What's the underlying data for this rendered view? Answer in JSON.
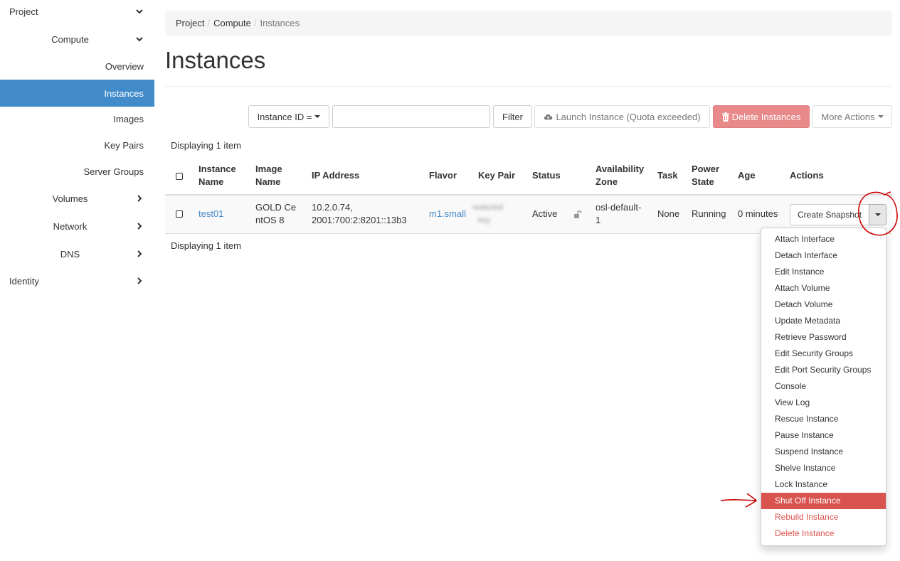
{
  "sidebar": {
    "project": "Project",
    "compute": "Compute",
    "overview": "Overview",
    "instances": "Instances",
    "images": "Images",
    "key_pairs": "Key Pairs",
    "server_groups": "Server Groups",
    "volumes": "Volumes",
    "network": "Network",
    "dns": "DNS",
    "identity": "Identity",
    "active_item": "Instances"
  },
  "breadcrumb": {
    "items": [
      "Project",
      "Compute",
      "Instances"
    ],
    "separator": "/"
  },
  "page_title": "Instances",
  "toolbar": {
    "filter_type": "Instance ID =",
    "search_value": "",
    "filter_label": "Filter",
    "launch_label": "Launch Instance (Quota exceeded)",
    "delete_label": "Delete Instances",
    "more_label": "More Actions"
  },
  "display_count": "Displaying 1 item",
  "table": {
    "headers": {
      "instance_name": [
        "Instance",
        "Name"
      ],
      "image_name": [
        "Image",
        "Name"
      ],
      "ip_address": "IP Address",
      "flavor": "Flavor",
      "key_pair": "Key Pair",
      "status": "Status",
      "availability_zone": [
        "Availability",
        "Zone"
      ],
      "task": "Task",
      "power_state": [
        "Power",
        "State"
      ],
      "age": "Age",
      "actions": "Actions"
    },
    "rows": [
      {
        "instance_name": "test01",
        "image_name": [
          "GOLD Ce",
          "ntOS 8"
        ],
        "ip_address": [
          "10.2.0.74,",
          "2001:700:2:8201::13b3"
        ],
        "flavor": "m1.small",
        "key_pair": [
          "redacted",
          "key"
        ],
        "status": "Active",
        "availability_zone": [
          "osl-default-",
          "1"
        ],
        "task": "None",
        "power_state": "Running",
        "age": "0 minutes",
        "action_primary": "Create Snapshot"
      }
    ]
  },
  "actions_menu": {
    "items": [
      {
        "label": "Attach Interface",
        "style": "normal"
      },
      {
        "label": "Detach Interface",
        "style": "normal"
      },
      {
        "label": "Edit Instance",
        "style": "normal"
      },
      {
        "label": "Attach Volume",
        "style": "normal"
      },
      {
        "label": "Detach Volume",
        "style": "normal"
      },
      {
        "label": "Update Metadata",
        "style": "normal"
      },
      {
        "label": "Retrieve Password",
        "style": "normal"
      },
      {
        "label": "Edit Security Groups",
        "style": "normal"
      },
      {
        "label": "Edit Port Security Groups",
        "style": "normal"
      },
      {
        "label": "Console",
        "style": "normal"
      },
      {
        "label": "View Log",
        "style": "normal"
      },
      {
        "label": "Rescue Instance",
        "style": "normal"
      },
      {
        "label": "Pause Instance",
        "style": "normal"
      },
      {
        "label": "Suspend Instance",
        "style": "normal"
      },
      {
        "label": "Shelve Instance",
        "style": "normal"
      },
      {
        "label": "Lock Instance",
        "style": "normal"
      },
      {
        "label": "Shut Off Instance",
        "style": "highlighted"
      },
      {
        "label": "Rebuild Instance",
        "style": "danger"
      },
      {
        "label": "Delete Instance",
        "style": "danger"
      }
    ]
  },
  "colors": {
    "primary": "#428bca",
    "danger": "#d9534f",
    "annotation": "#cc0000"
  }
}
